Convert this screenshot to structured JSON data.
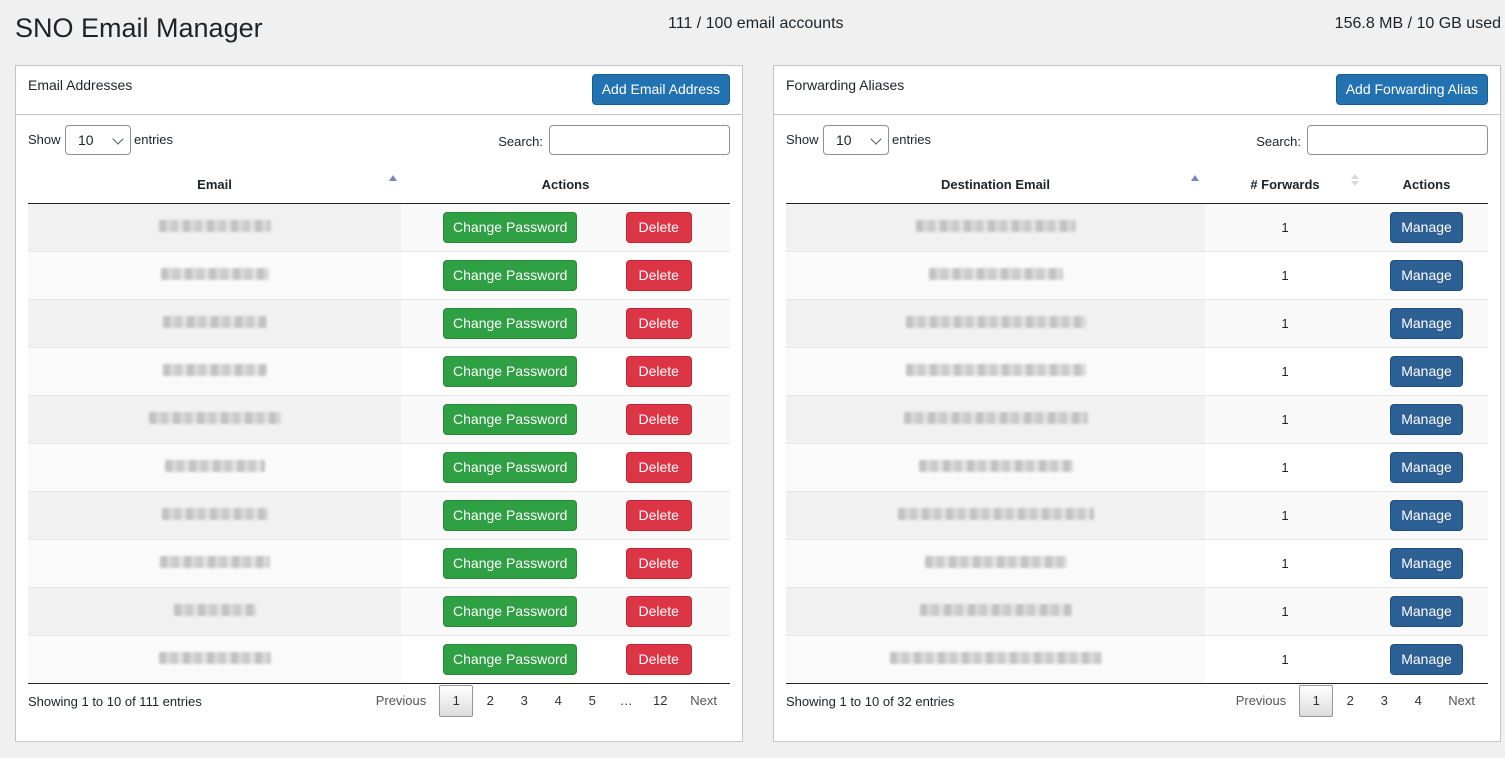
{
  "header": {
    "title": "SNO Email Manager",
    "accounts": "111 / 100 email accounts",
    "storage": "156.8 MB / 10 GB used"
  },
  "left": {
    "title": "Email Addresses",
    "add_button": "Add Email Address",
    "show": "Show",
    "entries_value": "10",
    "entries": "entries",
    "search": "Search:",
    "columns": [
      "Email",
      "Actions"
    ],
    "change_password": "Change Password",
    "delete": "Delete",
    "info": "Showing 1 to 10 of 111 entries",
    "pages": [
      "Previous",
      "1",
      "2",
      "3",
      "4",
      "5",
      "…",
      "12",
      "Next"
    ]
  },
  "right": {
    "title": "Forwarding Aliases",
    "add_button": "Add Forwarding Alias",
    "show": "Show",
    "entries_value": "10",
    "entries": "entries",
    "search": "Search:",
    "columns": [
      "Destination Email",
      "# Forwards",
      "Actions"
    ],
    "forwards": [
      "1",
      "1",
      "1",
      "1",
      "1",
      "1",
      "1",
      "1",
      "1",
      "1"
    ],
    "manage": "Manage",
    "info": "Showing 1 to 10 of 32 entries",
    "pages": [
      "Previous",
      "1",
      "2",
      "3",
      "4",
      "Next"
    ]
  },
  "colors": {
    "primary": "#2271b1",
    "green": "#2ea043",
    "red": "#dc3545",
    "manage": "#2c5f94",
    "sort_active": "#7b84c7"
  }
}
